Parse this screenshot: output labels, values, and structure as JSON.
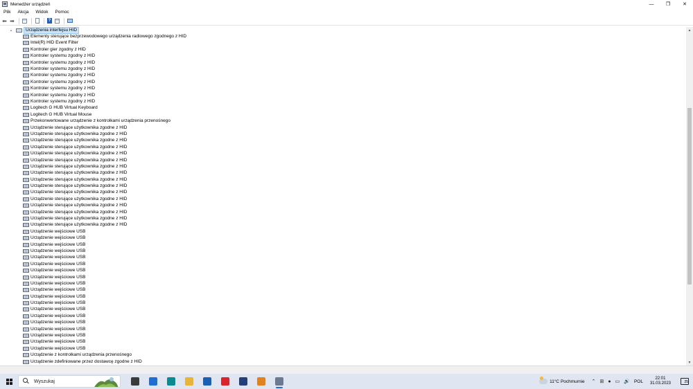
{
  "window": {
    "title": "Menedżer urządzeń",
    "controls": {
      "minimize": "—",
      "restore": "❐",
      "close": "✕"
    }
  },
  "menu": [
    {
      "label": "Plik"
    },
    {
      "label": "Akcja"
    },
    {
      "label": "Widok"
    },
    {
      "label": "Pomoc"
    }
  ],
  "toolbar": {
    "back_glyph": "⬅",
    "forward_glyph": "➡",
    "help_glyph": "?"
  },
  "tree": {
    "expander_glyph": "⌄",
    "category": {
      "label": "Urządzenia interfejsu HID",
      "icon": "hid-category-icon",
      "selected": true
    },
    "devices": [
      {
        "label": "Elementy sterujące bezprzewodowego urządzenia radiowego zgodnego z HID"
      },
      {
        "label": "Intel(R) HID Event Filter"
      },
      {
        "label": "Kontroler gier zgodny z HID"
      },
      {
        "label": "Kontroler systemu zgodny z HID"
      },
      {
        "label": "Kontroler systemu zgodny z HID"
      },
      {
        "label": "Kontroler systemu zgodny z HID"
      },
      {
        "label": "Kontroler systemu zgodny z HID"
      },
      {
        "label": "Kontroler systemu zgodny z HID"
      },
      {
        "label": "Kontroler systemu zgodny z HID"
      },
      {
        "label": "Kontroler systemu zgodny z HID"
      },
      {
        "label": "Kontroler systemu zgodny z HID"
      },
      {
        "label": "Logitech G HUB Virtual Keyboard"
      },
      {
        "label": "Logitech G HUB Virtual Mouse"
      },
      {
        "label": "Przekonwertowane urządzenie z kontrolkami urządzenia przenośnego"
      },
      {
        "label": "Urządzenie sterujące użytkownika zgodne z HID"
      },
      {
        "label": "Urządzenie sterujące użytkownika zgodne z HID"
      },
      {
        "label": "Urządzenie sterujące użytkownika zgodne z HID"
      },
      {
        "label": "Urządzenie sterujące użytkownika zgodne z HID"
      },
      {
        "label": "Urządzenie sterujące użytkownika zgodne z HID"
      },
      {
        "label": "Urządzenie sterujące użytkownika zgodne z HID"
      },
      {
        "label": "Urządzenie sterujące użytkownika zgodne z HID"
      },
      {
        "label": "Urządzenie sterujące użytkownika zgodne z HID"
      },
      {
        "label": "Urządzenie sterujące użytkownika zgodne z HID"
      },
      {
        "label": "Urządzenie sterujące użytkownika zgodne z HID"
      },
      {
        "label": "Urządzenie sterujące użytkownika zgodne z HID"
      },
      {
        "label": "Urządzenie sterujące użytkownika zgodne z HID"
      },
      {
        "label": "Urządzenie sterujące użytkownika zgodne z HID"
      },
      {
        "label": "Urządzenie sterujące użytkownika zgodne z HID"
      },
      {
        "label": "Urządzenie sterujące użytkownika zgodne z HID"
      },
      {
        "label": "Urządzenie sterujące użytkownika zgodne z HID"
      },
      {
        "label": "Urządzenie wejściowe USB"
      },
      {
        "label": "Urządzenie wejściowe USB"
      },
      {
        "label": "Urządzenie wejściowe USB"
      },
      {
        "label": "Urządzenie wejściowe USB"
      },
      {
        "label": "Urządzenie wejściowe USB"
      },
      {
        "label": "Urządzenie wejściowe USB"
      },
      {
        "label": "Urządzenie wejściowe USB"
      },
      {
        "label": "Urządzenie wejściowe USB"
      },
      {
        "label": "Urządzenie wejściowe USB"
      },
      {
        "label": "Urządzenie wejściowe USB"
      },
      {
        "label": "Urządzenie wejściowe USB"
      },
      {
        "label": "Urządzenie wejściowe USB"
      },
      {
        "label": "Urządzenie wejściowe USB"
      },
      {
        "label": "Urządzenie wejściowe USB"
      },
      {
        "label": "Urządzenie wejściowe USB"
      },
      {
        "label": "Urządzenie wejściowe USB"
      },
      {
        "label": "Urządzenie wejściowe USB"
      },
      {
        "label": "Urządzenie wejściowe USB"
      },
      {
        "label": "Urządzenie wejściowe USB"
      },
      {
        "label": "Urządzenie z kontrolkami urządzenia przenośnego"
      },
      {
        "label": "Urządzenie zdefiniowane przez dostawcę zgodne z HID"
      }
    ]
  },
  "scrollbar": {
    "up_glyph": "▲",
    "down_glyph": "▼"
  },
  "taskbar": {
    "search_placeholder": "Wyszukaj",
    "apps": [
      {
        "name": "task-view",
        "color": "#3b3b3b",
        "glyph": "▦"
      },
      {
        "name": "microsoft-store",
        "color": "#1f6fd0",
        "glyph": "■"
      },
      {
        "name": "edge",
        "color": "#0c8a8f",
        "glyph": "●"
      },
      {
        "name": "file-explorer",
        "color": "#e8b33a",
        "glyph": "▬"
      },
      {
        "name": "mail",
        "color": "#1a5fb4",
        "glyph": "✉"
      },
      {
        "name": "opera",
        "color": "#d9242b",
        "glyph": "O"
      },
      {
        "name": "app-blue",
        "color": "#23407a",
        "glyph": "●"
      },
      {
        "name": "app-orange",
        "color": "#e0821d",
        "glyph": "◆"
      },
      {
        "name": "device-manager",
        "color": "#6b7a90",
        "glyph": "▣"
      }
    ],
    "weather": {
      "temp": "11°C",
      "condition": "Pochmurnie"
    },
    "tray_icons": {
      "chevron": "⌃",
      "network": "⊞",
      "mic": "●",
      "display": "▭",
      "volume": "🔊"
    },
    "language": "POL",
    "time": "22:01",
    "date": "31.03.2023",
    "notifications_count": "25"
  }
}
